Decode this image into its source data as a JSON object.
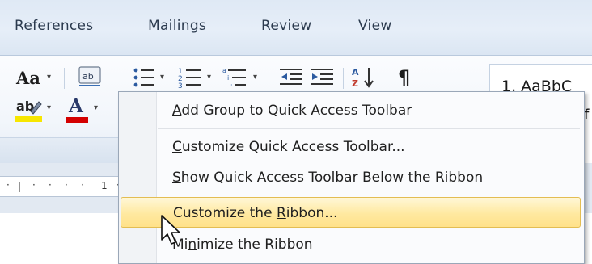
{
  "tabs": [
    "References",
    "Mailings",
    "Review",
    "View"
  ],
  "ribbon": {
    "change_case_label": "Aa",
    "font_color_letter": "A",
    "highlight_label": "ab",
    "sort_label": "A Z",
    "show_marks_glyph": "¶",
    "styles_gallery_preview": "1. AaBbC",
    "styles_gallery_second": "f"
  },
  "ruler": {
    "number": "1"
  },
  "context_menu": {
    "items": [
      {
        "text": "Add Group to Quick Access Toolbar",
        "accel_index": 0
      },
      {
        "text": "Customize Quick Access Toolbar...",
        "accel_index": 0
      },
      {
        "text": "Show Quick Access Toolbar Below the Ribbon",
        "accel_index": 0
      },
      {
        "text": "Customize the Ribbon...",
        "accel_index": 14,
        "hovered": true
      },
      {
        "text": "Minimize the Ribbon",
        "accel_index": 2
      }
    ]
  },
  "colors": {
    "highlight_yellow": "#f7e600",
    "font_red": "#d40000",
    "hover_fill": "#ffe9a0",
    "hover_border": "#e3bd52"
  }
}
